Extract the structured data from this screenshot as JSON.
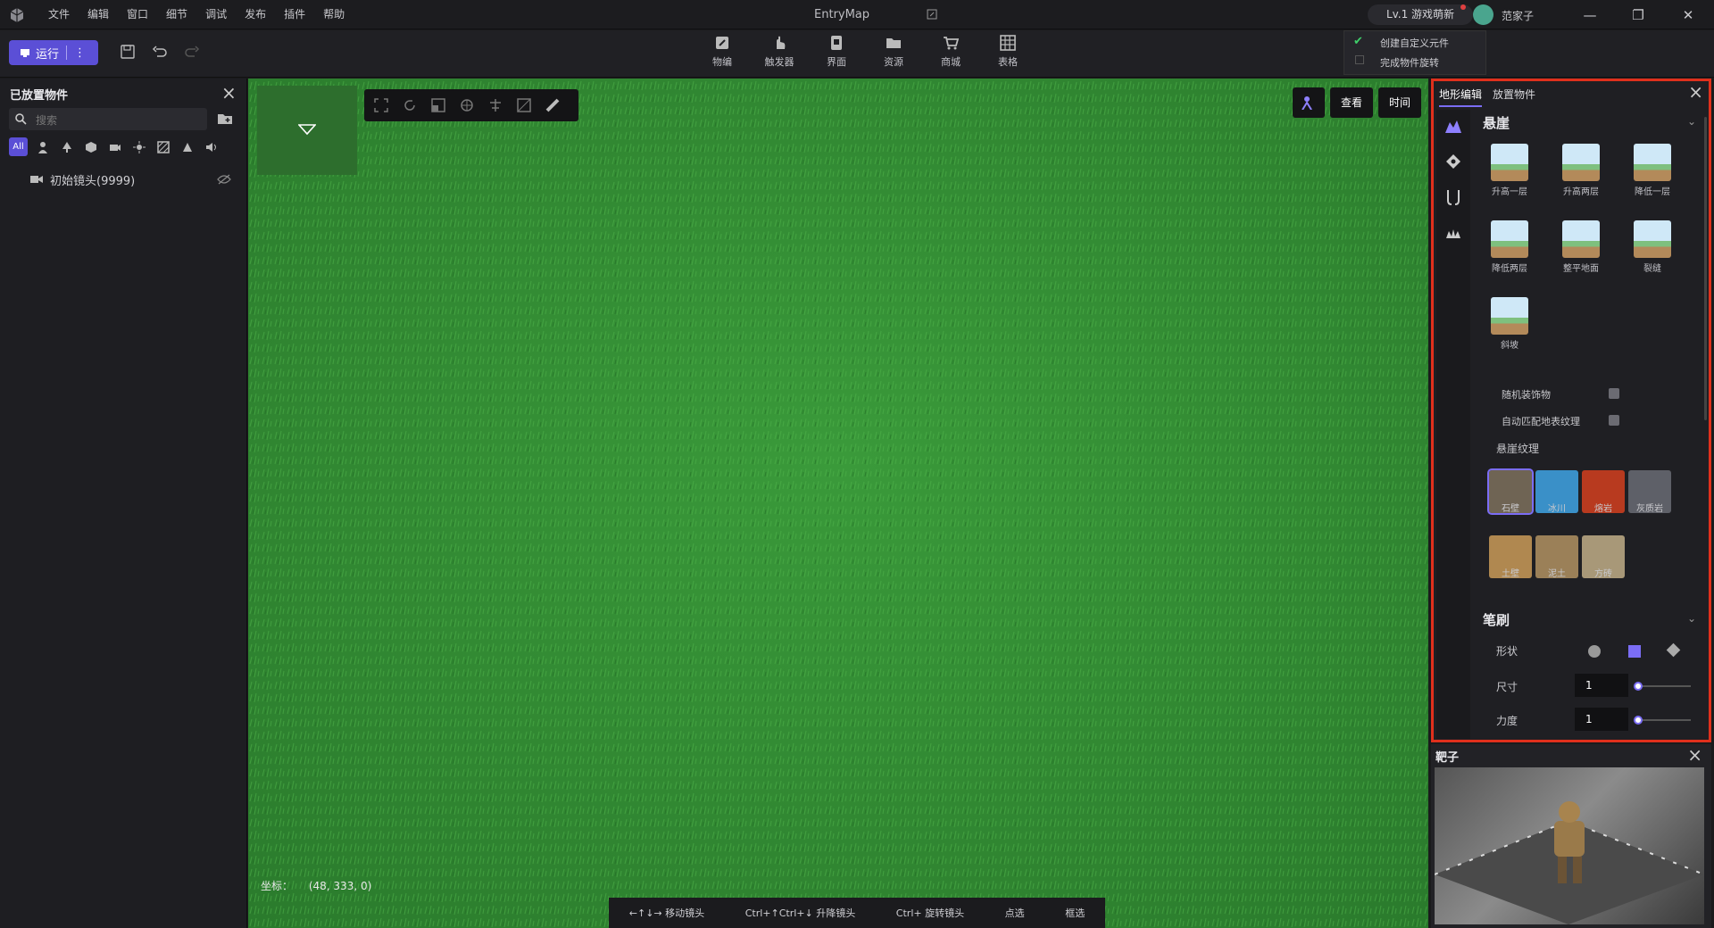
{
  "menu": [
    "文件",
    "编辑",
    "窗口",
    "细节",
    "调试",
    "发布",
    "插件",
    "帮助"
  ],
  "window": {
    "title": "EntryMap",
    "level": "Lv.1 游戏萌新",
    "username": "范家子"
  },
  "toolbar": {
    "run_label": "运行",
    "tools": [
      {
        "label": "物编",
        "icon": "edit-icon"
      },
      {
        "label": "触发器",
        "icon": "hand-icon"
      },
      {
        "label": "界面",
        "icon": "ui-icon"
      },
      {
        "label": "资源",
        "icon": "folder-icon"
      },
      {
        "label": "商城",
        "icon": "cart-icon"
      },
      {
        "label": "表格",
        "icon": "table-icon"
      }
    ]
  },
  "checklist": [
    "创建自定义元件",
    "完成物件旋转"
  ],
  "left_panel": {
    "title": "已放置物件",
    "search_placeholder": "搜索",
    "items": [
      "初始镜头(9999)"
    ]
  },
  "viewport": {
    "coords_label": "坐标：",
    "coords_value": "(48, 333, 0)",
    "view_button": "查看",
    "time_button": "时间",
    "hints": [
      "←↑↓→ 移动镜头",
      "Ctrl+↑Ctrl+↓ 升降镜头",
      "Ctrl+ 旋转镜头",
      "点选",
      "框选"
    ]
  },
  "right_panel": {
    "tabs": [
      "地形编辑",
      "放置物件"
    ],
    "cliff_title": "悬崖",
    "cliff_tools": [
      "升高一层",
      "升高两层",
      "降低一层",
      "降低两层",
      "整平地面",
      "裂缝",
      "斜坡"
    ],
    "options": [
      "随机装饰物",
      "自动匹配地表纹理"
    ],
    "texture_title": "悬崖纹理",
    "textures": [
      {
        "label": "石壁",
        "color": "#6f6454"
      },
      {
        "label": "冰川",
        "color": "#3a90c8"
      },
      {
        "label": "熔岩",
        "color": "#b83a1f"
      },
      {
        "label": "灰质岩",
        "color": "#5e6068"
      },
      {
        "label": "土壁",
        "color": "#b08850"
      },
      {
        "label": "泥土",
        "color": "#9b8058"
      },
      {
        "label": "方砖",
        "color": "#a89878"
      }
    ],
    "brush_title": "笔刷",
    "shape_label": "形状",
    "size_label": "尺寸",
    "size_value": "1",
    "strength_label": "力度",
    "strength_value": "1"
  },
  "preview": {
    "title": "靶子"
  }
}
